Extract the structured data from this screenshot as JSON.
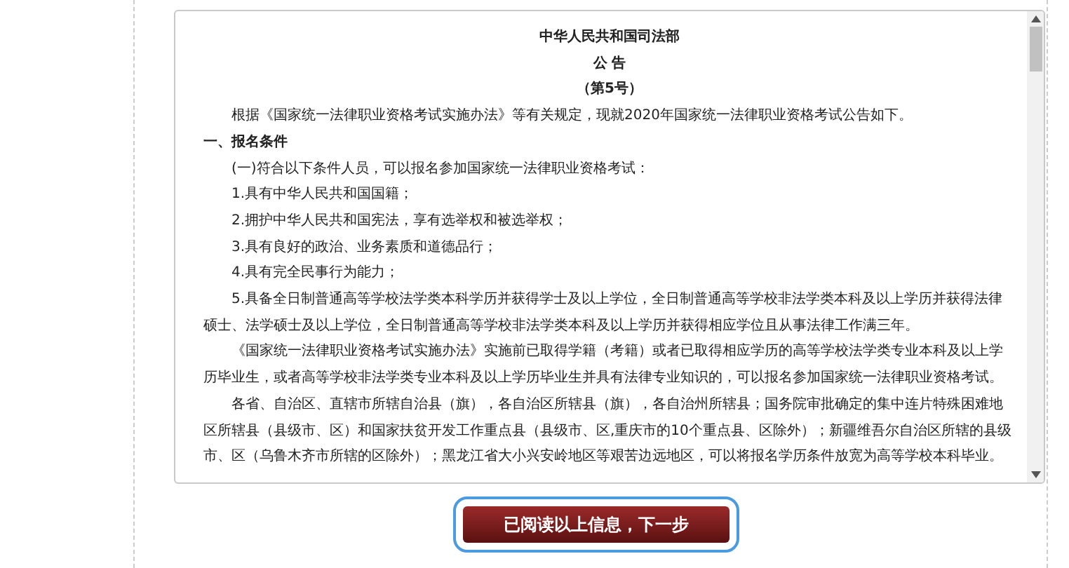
{
  "notice": {
    "issuer": "中华人民共和国司法部",
    "title": "公 告",
    "number": "（第5号）",
    "paragraphs": [
      {
        "kind": "body",
        "text": "根据《国家统一法律职业资格考试实施办法》等有关规定，现就2020年国家统一法律职业资格考试公告如下。"
      },
      {
        "kind": "heading",
        "text": "一、报名条件"
      },
      {
        "kind": "body",
        "text": "(一)符合以下条件人员，可以报名参加国家统一法律职业资格考试："
      },
      {
        "kind": "body",
        "text": "1.具有中华人民共和国国籍；"
      },
      {
        "kind": "body",
        "text": "2.拥护中华人民共和国宪法，享有选举权和被选举权；"
      },
      {
        "kind": "body",
        "text": "3.具有良好的政治、业务素质和道德品行；"
      },
      {
        "kind": "body",
        "text": "4.具有完全民事行为能力；"
      },
      {
        "kind": "body",
        "text": "5.具备全日制普通高等学校法学类本科学历并获得学士及以上学位，全日制普通高等学校非法学类本科及以上学历并获得法律硕士、法学硕士及以上学位，全日制普通高等学校非法学类本科及以上学历并获得相应学位且从事法律工作满三年。"
      },
      {
        "kind": "body",
        "text": "《国家统一法律职业资格考试实施办法》实施前已取得学籍（考籍）或者已取得相应学历的高等学校法学类专业本科及以上学历毕业生，或者高等学校非法学类专业本科及以上学历毕业生并具有法律专业知识的，可以报名参加国家统一法律职业资格考试。"
      },
      {
        "kind": "body",
        "text": "各省、自治区、直辖市所辖自治县（旗），各自治区所辖县（旗），各自治州所辖县；国务院审批确定的集中连片特殊困难地区所辖县（县级市、区）和国家扶贫开发工作重点县（县级市、区,重庆市的10个重点县、区除外）；新疆维吾尔自治区所辖的县级市、区（乌鲁木齐市所辖的区除外）；黑龙江省大小兴安岭地区等艰苦边远地区，可以将报名学历条件放宽为高等学校本科毕业。"
      }
    ]
  },
  "next_button": {
    "label": "已阅读以上信息，下一步"
  }
}
